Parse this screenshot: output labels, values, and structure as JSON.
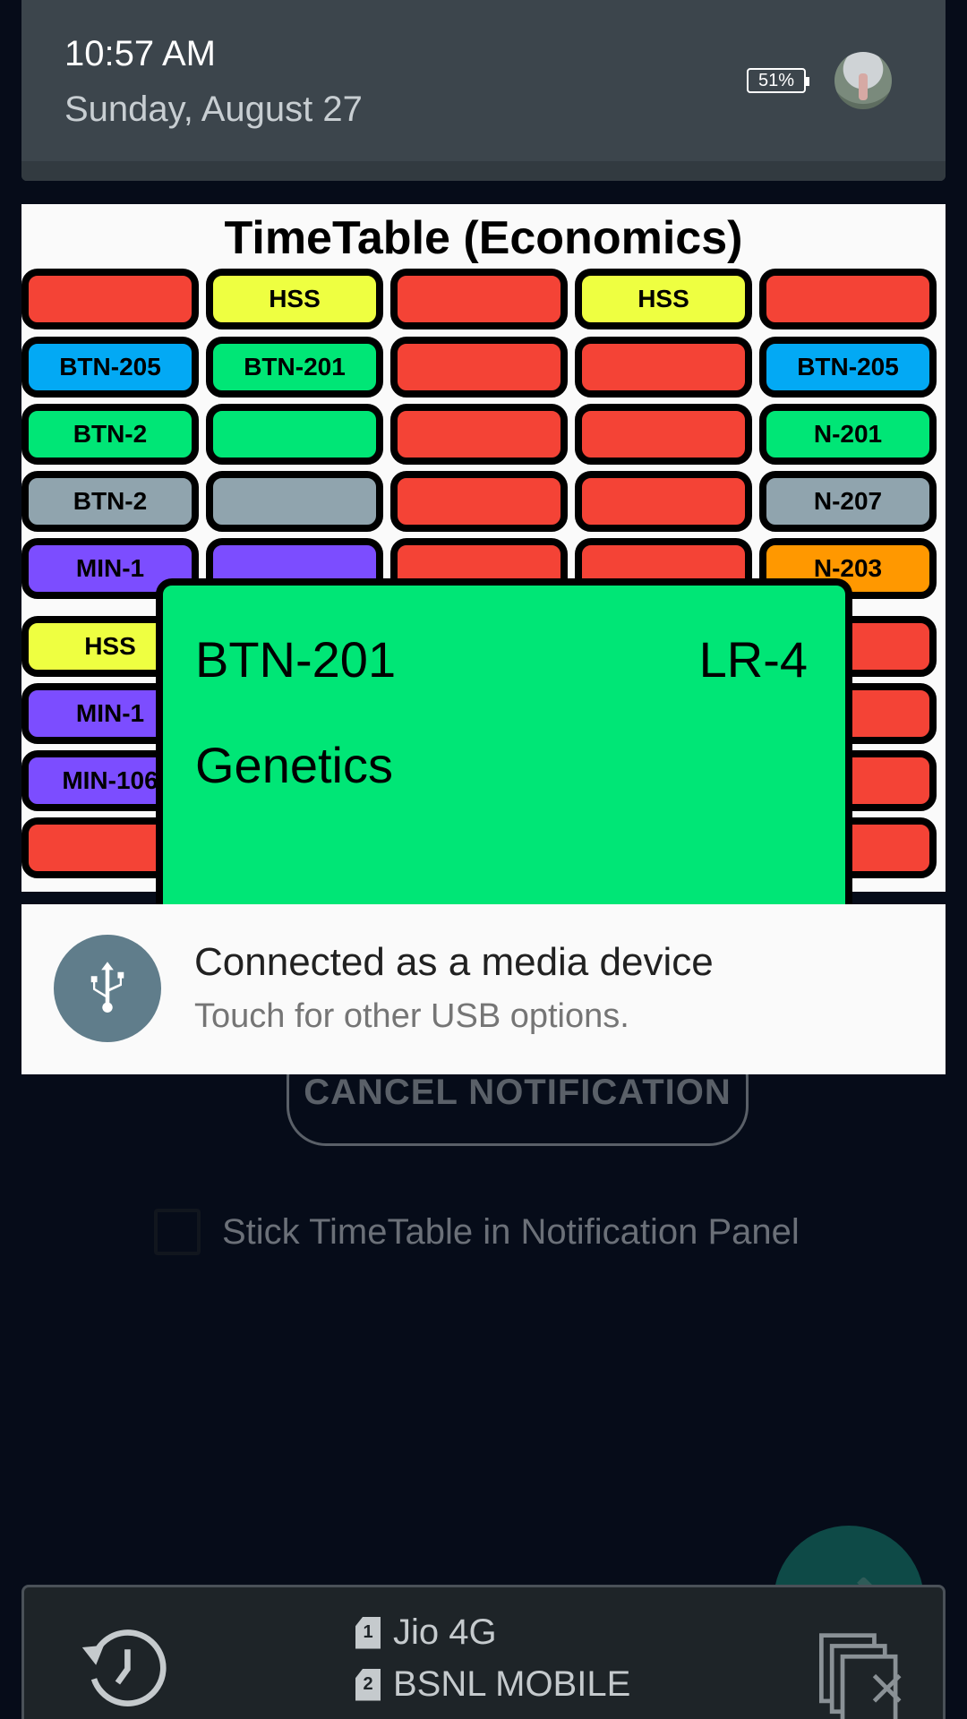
{
  "status": {
    "time": "10:57 AM",
    "date": "Sunday, August 27",
    "battery": "51%"
  },
  "background_app": {
    "cancel_button": "CANCEL NOTIFICATION",
    "stick_checkbox_label": "Stick TimeTable in Notification Panel",
    "fab_icon": "pencil-icon"
  },
  "timetable": {
    "title": "TimeTable (Economics)",
    "colors": {
      "red": "#f44336",
      "yellow": "#eeff41",
      "blue": "#03a9f4",
      "green": "#00e676",
      "grey": "#90a4ae",
      "purple": "#7c4dff",
      "orange": "#ff9800"
    },
    "rows": [
      [
        {
          "label": "",
          "color": "red"
        },
        {
          "label": "HSS",
          "color": "yellow"
        },
        {
          "label": "",
          "color": "red"
        },
        {
          "label": "HSS",
          "color": "yellow"
        },
        {
          "label": "",
          "color": "red"
        }
      ],
      [
        {
          "label": "BTN-205",
          "color": "blue"
        },
        {
          "label": "BTN-201",
          "color": "green"
        },
        {
          "label": "",
          "color": "red"
        },
        {
          "label": "",
          "color": "red"
        },
        {
          "label": "BTN-205",
          "color": "blue"
        }
      ],
      [
        {
          "label": "BTN-2",
          "color": "green"
        },
        {
          "label": "",
          "color": "green"
        },
        {
          "label": "",
          "color": "red"
        },
        {
          "label": "",
          "color": "red"
        },
        {
          "label": "N-201",
          "color": "green"
        }
      ],
      [
        {
          "label": "BTN-2",
          "color": "grey"
        },
        {
          "label": "",
          "color": "grey"
        },
        {
          "label": "",
          "color": "red"
        },
        {
          "label": "",
          "color": "red"
        },
        {
          "label": "N-207",
          "color": "grey"
        }
      ],
      [
        {
          "label": "MIN-1",
          "color": "purple"
        },
        {
          "label": "",
          "color": "purple"
        },
        {
          "label": "",
          "color": "red"
        },
        {
          "label": "",
          "color": "red"
        },
        {
          "label": "N-203",
          "color": "orange"
        }
      ],
      [
        {
          "label": "HSS",
          "color": "yellow"
        },
        {
          "label": "",
          "color": "red"
        },
        {
          "label": "",
          "color": "red"
        },
        {
          "label": "",
          "color": "red"
        },
        {
          "label": "",
          "color": "red"
        }
      ],
      [
        {
          "label": "MIN-1",
          "color": "purple"
        },
        {
          "label": "",
          "color": "red"
        },
        {
          "label": "",
          "color": "red"
        },
        {
          "label": "",
          "color": "red"
        },
        {
          "label": "",
          "color": "red"
        }
      ],
      [
        {
          "label": "MIN-106",
          "color": "purple"
        },
        {
          "label": "",
          "color": "red"
        },
        {
          "label": "",
          "color": "red"
        },
        {
          "label": "",
          "color": "red"
        },
        {
          "label": "",
          "color": "red"
        }
      ],
      [
        {
          "label": "",
          "color": "red"
        },
        {
          "label": "",
          "color": "red"
        },
        {
          "label": "",
          "color": "red"
        },
        {
          "label": "",
          "color": "red"
        },
        {
          "label": "",
          "color": "red"
        }
      ]
    ],
    "popup": {
      "code": "BTN-201",
      "room": "LR-4",
      "subject": "Genetics"
    }
  },
  "usb_notification": {
    "icon": "usb-icon",
    "title": "Connected as a media device",
    "subtitle": "Touch for other USB options."
  },
  "bottom_bar": {
    "history_icon": "history-icon",
    "sim1": {
      "slot": "1",
      "carrier": "Jio 4G"
    },
    "sim2": {
      "slot": "2",
      "carrier": "BSNL MOBILE"
    },
    "clear_icon": "clear-all-icon"
  }
}
